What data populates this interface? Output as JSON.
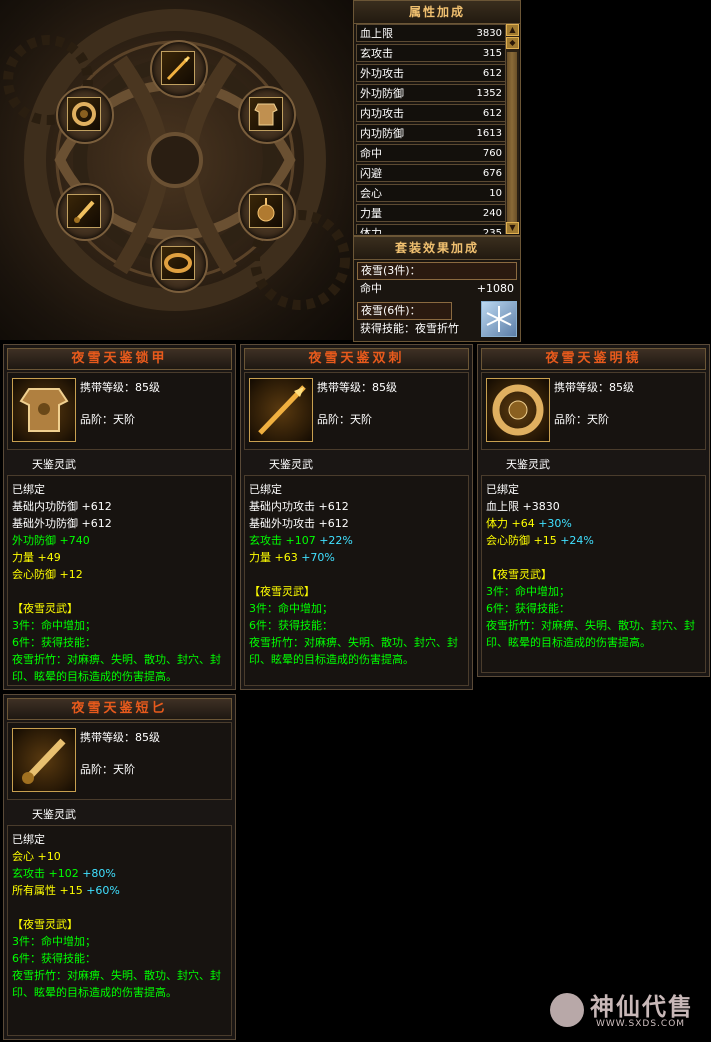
{
  "attributes": {
    "title": "属性加成",
    "rows": [
      {
        "name": "血上限",
        "value": "3830"
      },
      {
        "name": "玄攻击",
        "value": "315"
      },
      {
        "name": "外功攻击",
        "value": "612"
      },
      {
        "name": "外功防御",
        "value": "1352"
      },
      {
        "name": "内功攻击",
        "value": "612"
      },
      {
        "name": "内功防御",
        "value": "1613"
      },
      {
        "name": "命中",
        "value": "760"
      },
      {
        "name": "闪避",
        "value": "676"
      },
      {
        "name": "会心",
        "value": "10"
      },
      {
        "name": "力量",
        "value": "240"
      },
      {
        "name": "体力",
        "value": "235"
      }
    ]
  },
  "set_effect": {
    "title": "套装效果加成",
    "tier3_label": "夜雪(3件)：",
    "tier3_stat": "命中",
    "tier3_value": "+1080",
    "tier6_label": "夜雪(6件)：",
    "tier6_skill": "获得技能：夜雪折竹"
  },
  "cards": [
    {
      "title": "夜雪天鉴锁甲",
      "level": "携带等级：85级",
      "grade": "品阶：天阶",
      "series": "天鉴灵武",
      "bound": "已绑定",
      "stats": [
        {
          "text": "基础内功防御 +612",
          "bonus": ""
        },
        {
          "text": "基础外功防御 +612",
          "bonus": ""
        },
        {
          "text": "外功防御 +740",
          "bonus": ""
        },
        {
          "text": "力量 +49",
          "bonus": ""
        },
        {
          "text": "会心防御 +12",
          "bonus": ""
        }
      ],
      "set_name": "【夜雪灵武】",
      "set3": "3件：命中增加；",
      "set6": "6件：获得技能：",
      "skill_desc": "夜雪折竹：对麻痹、失明、散功、封穴、封印、眩晕的目标造成的伤害提高。"
    },
    {
      "title": "夜雪天鉴双刺",
      "level": "携带等级：85级",
      "grade": "品阶：天阶",
      "series": "天鉴灵武",
      "bound": "已绑定",
      "stats": [
        {
          "text": "基础内功攻击 +612",
          "bonus": ""
        },
        {
          "text": "基础外功攻击 +612",
          "bonus": ""
        },
        {
          "text": "玄攻击 +107",
          "bonus": "+22%"
        },
        {
          "text": "力量 +63",
          "bonus": "+70%"
        }
      ],
      "set_name": "【夜雪灵武】",
      "set3": "3件：命中增加；",
      "set6": "6件：获得技能：",
      "skill_desc": "夜雪折竹：对麻痹、失明、散功、封穴、封印、眩晕的目标造成的伤害提高。"
    },
    {
      "title": "夜雪天鉴明镜",
      "level": "携带等级：85级",
      "grade": "品阶：天阶",
      "series": "天鉴灵武",
      "bound": "已绑定",
      "stats": [
        {
          "text": "血上限 +3830",
          "bonus": ""
        },
        {
          "text": "体力 +64",
          "bonus": "+30%"
        },
        {
          "text": "会心防御 +15",
          "bonus": "+24%"
        }
      ],
      "set_name": "【夜雪灵武】",
      "set3": "3件：命中增加；",
      "set6": "6件：获得技能：",
      "skill_desc": "夜雪折竹：对麻痹、失明、散功、封穴、封印、眩晕的目标造成的伤害提高。"
    },
    {
      "title": "夜雪天鉴短匕",
      "level": "携带等级：85级",
      "grade": "品阶：天阶",
      "series": "天鉴灵武",
      "bound": "已绑定",
      "stats": [
        {
          "text": "会心 +10",
          "bonus": ""
        },
        {
          "text": "玄攻击 +102",
          "bonus": "+80%"
        },
        {
          "text": "所有属性 +15",
          "bonus": "+60%"
        }
      ],
      "set_name": "【夜雪灵武】",
      "set3": "3件：命中增加；",
      "set6": "6件：获得技能：",
      "skill_desc": "夜雪折竹：对麻痹、失明、散功、封穴、封印、眩晕的目标造成的伤害提高。"
    }
  ],
  "watermark": {
    "brand": "神仙代售",
    "url": "WWW.SXDS.COM"
  }
}
